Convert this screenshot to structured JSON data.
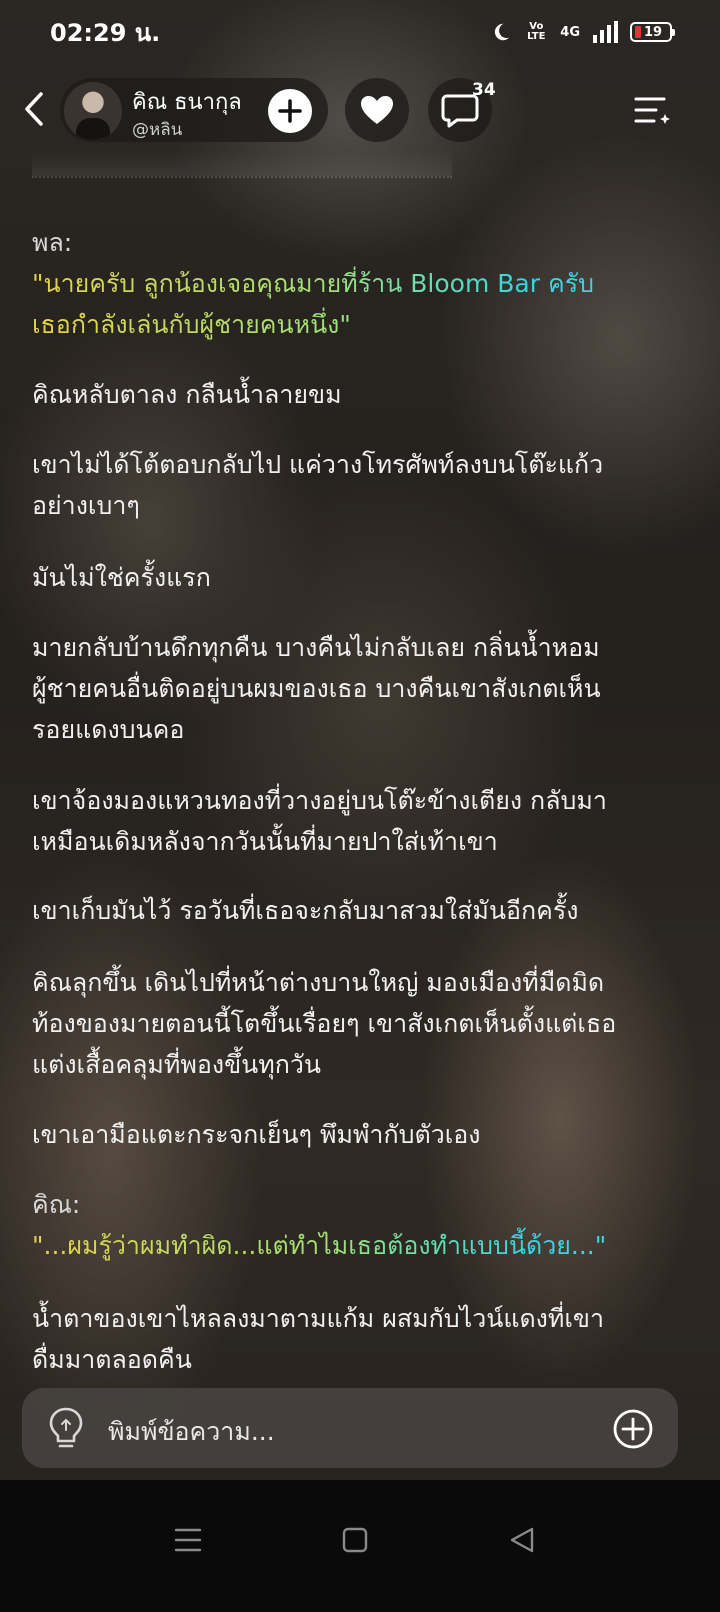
{
  "status_bar": {
    "time": "02:29 น.",
    "volte": "Vo LTE",
    "network": "4G",
    "battery": "19"
  },
  "header": {
    "author_name": "คิณ ธนากุล",
    "author_handle": "@หลิน",
    "comment_count": "34"
  },
  "story": {
    "paragraphs": [
      {
        "speaker": "พล:",
        "dialog_line1": "\"นายครับ ลูกน้องเจอคุณมายที่ร้าน Bloom Bar ครับ",
        "dialog_line2": "เธอกำลังเล่นกับผู้ชายคนหนึ่ง\""
      },
      {
        "text": "คิณหลับตาลง กลืนน้ำลายขม"
      },
      {
        "line1": "เขาไม่ได้โต้ตอบกลับไป แค่วางโทรศัพท์ลงบนโต๊ะแก้ว",
        "line2": "อย่างเบาๆ"
      },
      {
        "text": "มันไม่ใช่ครั้งแรก"
      },
      {
        "line1": "มายกลับบ้านดึกทุกคืน บางคืนไม่กลับเลย กลิ่นน้ำหอม",
        "line2": "ผู้ชายคนอื่นติดอยู่บนผมของเธอ บางคืนเขาสังเกตเห็น",
        "line3": "รอยแดงบนคอ"
      },
      {
        "line1": "เขาจ้องมองแหวนทองที่วางอยู่บนโต๊ะข้างเตียง กลับมา",
        "line2": "เหมือนเดิมหลังจากวันนั้นที่มายปาใส่เท้าเขา"
      },
      {
        "text": "เขาเก็บมันไว้ รอวันที่เธอจะกลับมาสวมใส่มันอีกครั้ง"
      },
      {
        "line1": "คิณลุกขึ้น เดินไปที่หน้าต่างบานใหญ่ มองเมืองที่มืดมิด",
        "line2": "ท้องของมายตอนนี้โตขึ้นเรื่อยๆ เขาสังเกตเห็นตั้งแต่เธอ",
        "line3": "แต่งเสื้อคลุมที่พองขึ้นทุกวัน"
      },
      {
        "text": "เขาเอามือแตะกระจกเย็นๆ พึมพำกับตัวเอง"
      },
      {
        "speaker": "คิณ:",
        "dialog_line1": "\"...ผมรู้ว่าผมทำผิด...แต่ทำไมเธอต้องทำแบบนี้ด้วย...\""
      },
      {
        "line1": "น้ำตาของเขาไหลลงมาตามแก้ม ผสมกับไวน์แดงที่เขา",
        "line2": "ดื่มมาตลอดคืน"
      }
    ]
  },
  "input": {
    "placeholder": "พิมพ์ข้อความ..."
  },
  "colors": {
    "dialog_start": "#e6d24a",
    "dialog_end": "#35d6e4",
    "battery_low": "#e5313a"
  }
}
